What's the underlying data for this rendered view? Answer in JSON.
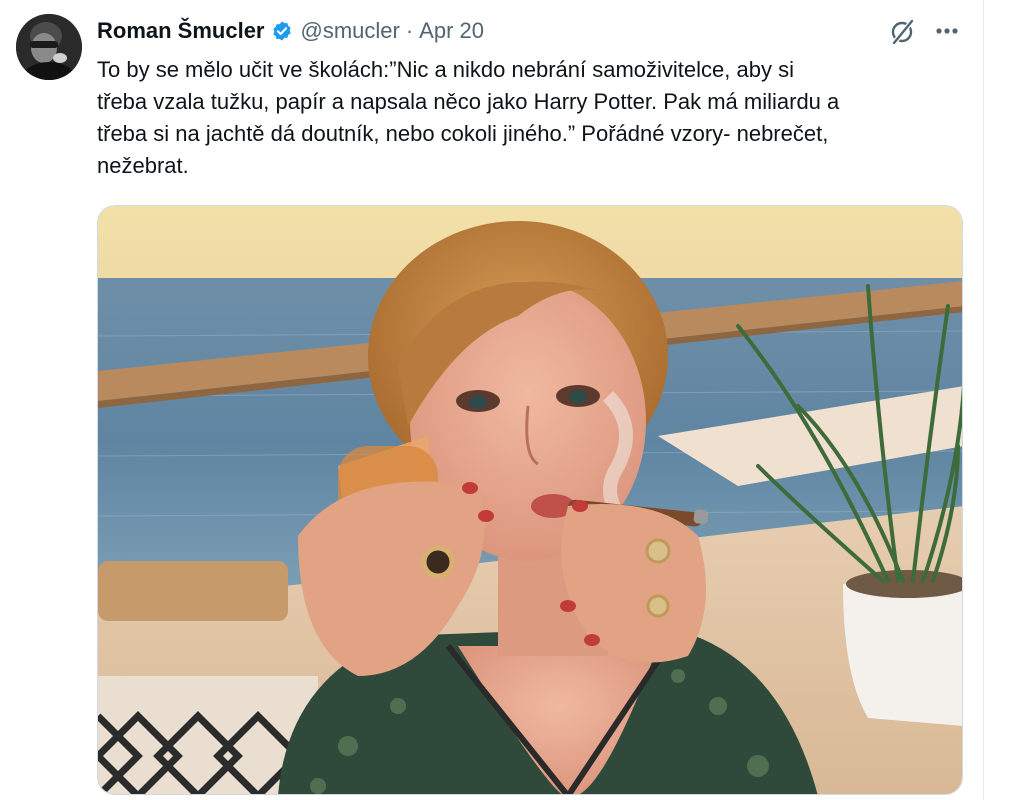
{
  "tweet": {
    "author_name": "Roman Šmucler",
    "verified": true,
    "handle": "@smucler",
    "separator": "·",
    "timestamp": "Apr 20",
    "text": "To by se mělo učit ve školách:”Nic a nikdo nebrání samoživitelce, aby si\ntřeba vzala tužku, papír a napsala něco jako Harry Potter. Pak má miliardu a\ntřeba si na jachtě dá doutník, nebo cokoli jiného.” Pořádné vzory- nebrečet,\nnežebrat.",
    "icons": {
      "verified": "verified-badge-icon",
      "grok": "grok-icon",
      "more": "more-options-icon"
    },
    "media": {
      "type": "photo"
    }
  },
  "colors": {
    "verified_blue": "#1d9bf0",
    "secondary_text": "#536471",
    "primary_text": "#0f1419"
  }
}
